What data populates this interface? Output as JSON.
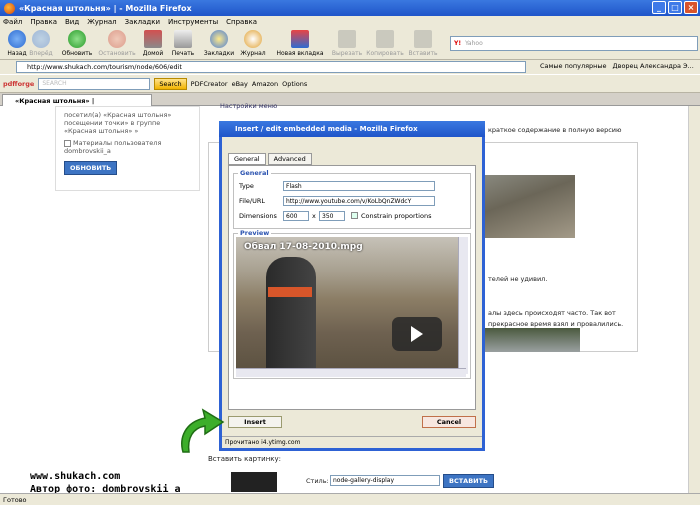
{
  "window": {
    "title": "«Красная штольня» | - Mozilla Firefox"
  },
  "menu": [
    "Файл",
    "Правка",
    "Вид",
    "Журнал",
    "Закладки",
    "Инструменты",
    "Справка"
  ],
  "toolbar": {
    "back": "Назад",
    "forward": "Вперёд",
    "refresh": "Обновить",
    "stop": "Остановить",
    "home": "Домой",
    "print": "Печать",
    "bookmarks": "Закладки",
    "history": "Журнал",
    "newtab": "Новая вкладка",
    "cut": "Вырезать",
    "copy": "Копировать",
    "paste": "Вставить",
    "search_placeholder": "Yahoo"
  },
  "address": {
    "url": "http://www.shukach.com/tourism/node/606/edit",
    "bm1": "Самые популярные",
    "bm2": "Дворец Александра Э..."
  },
  "yahoo_bar": {
    "pdfforge": "pdfforge",
    "search_placeholder": "SEARCH",
    "search_btn": "Search",
    "pdfcreator": "PDFCreator",
    "ebay": "eBay",
    "amazon": "Amazon",
    "options": "Options"
  },
  "tab": {
    "label": "«Красная штольня» |"
  },
  "sidebar": {
    "line1": "посетил(а) «Красная штольня»",
    "line2": "посещении точки» в группе",
    "line3": "«Красная штольня» »",
    "materials": "Материалы пользователя",
    "user": "dombrovskii_a",
    "update_btn": "ОБНОВИТЬ"
  },
  "page": {
    "settings_link": "Настройки меню",
    "summary_hint": "краткое содержание в полную версию",
    "text1": "телей не удивил.",
    "text2": "алы здесь происходят часто. Так вот",
    "text3": "прекрасное время взял и провалились.",
    "insert_image_label": "Вставить картинку:",
    "style_label": "Стиль:",
    "style_value": "node-gallery-display",
    "insert_btn": "ВСТАВИТЬ"
  },
  "dialog": {
    "title": "Insert / edit embedded media - Mozilla Firefox",
    "tab_general": "General",
    "tab_advanced": "Advanced",
    "legend_general": "General",
    "type_label": "Type",
    "type_value": "Flash",
    "file_label": "File/URL",
    "file_value": "http://www.youtube.com/v/KoLbQnZWdcY",
    "dim_label": "Dimensions",
    "width": "600",
    "x": "x",
    "height": "350",
    "constrain": "Constrain proportions",
    "legend_preview": "Preview",
    "video_title": "Обвал 17-08-2010.mpg",
    "insert": "Insert",
    "cancel": "Cancel",
    "status": "Прочитано i4.ytimg.com"
  },
  "status": {
    "text": "Готово"
  },
  "watermark": {
    "line1": "www.shukach.com",
    "line2": "Автор фото: dombrovskii_a"
  }
}
